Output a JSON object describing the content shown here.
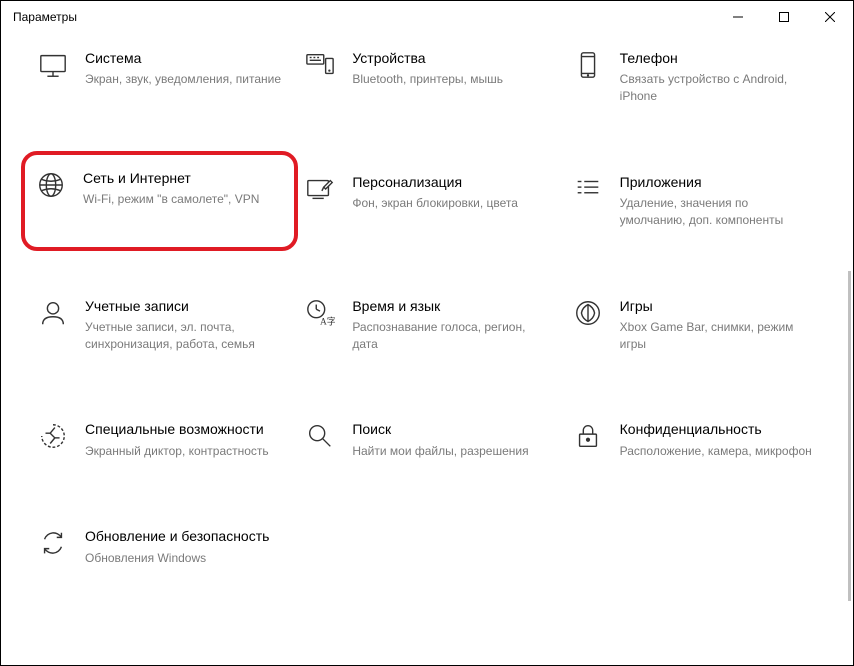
{
  "window": {
    "title": "Параметры"
  },
  "tiles": [
    {
      "title": "Система",
      "desc": "Экран, звук, уведомления, питание"
    },
    {
      "title": "Устройства",
      "desc": "Bluetooth, принтеры, мышь"
    },
    {
      "title": "Телефон",
      "desc": "Связать устройство с Android, iPhone"
    },
    {
      "title": "Сеть и Интернет",
      "desc": "Wi-Fi, режим \"в самолете\", VPN"
    },
    {
      "title": "Персонализация",
      "desc": "Фон, экран блокировки, цвета"
    },
    {
      "title": "Приложения",
      "desc": "Удаление, значения по умолчанию, доп. компоненты"
    },
    {
      "title": "Учетные записи",
      "desc": "Учетные записи, эл. почта, синхронизация, работа, семья"
    },
    {
      "title": "Время и язык",
      "desc": "Распознавание голоса, регион, дата"
    },
    {
      "title": "Игры",
      "desc": "Xbox Game Bar, снимки, режим игры"
    },
    {
      "title": "Специальные возможности",
      "desc": "Экранный диктор, контрастность"
    },
    {
      "title": "Поиск",
      "desc": "Найти мои файлы, разрешения"
    },
    {
      "title": "Конфиденциальность",
      "desc": "Расположение, камера, микрофон"
    },
    {
      "title": "Обновление и безопасность",
      "desc": "Обновления Windows"
    }
  ]
}
